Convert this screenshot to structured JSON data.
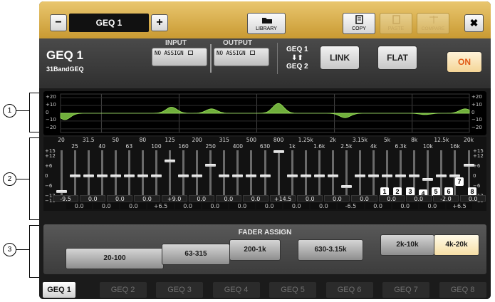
{
  "window": {
    "title": "GEQ 1",
    "minus_label": "−",
    "plus_label": "+",
    "library_label": "LIBRARY",
    "copy_label": "COPY",
    "paste_label": "PASTE",
    "compare_label": "COMPARE",
    "close_label": "✖"
  },
  "header": {
    "name": "GEQ 1",
    "type": "31BandGEQ",
    "input_label": "INPUT",
    "output_label": "OUTPUT",
    "input_value": "NO ASSIGN",
    "output_value": "NO ASSIGN",
    "link_top": "GEQ 1",
    "link_bottom": "GEQ 2",
    "link_label": "LINK",
    "flat_label": "FLAT",
    "on_label": "ON"
  },
  "graph": {
    "y_labels": [
      "+20",
      "+10",
      "0",
      "−10",
      "−20"
    ]
  },
  "bands": {
    "frequencies": [
      "20",
      "25",
      "31.5",
      "40",
      "50",
      "63",
      "80",
      "100",
      "125",
      "160",
      "200",
      "250",
      "315",
      "400",
      "500",
      "630",
      "800",
      "1k",
      "1.25k",
      "1.6k",
      "2k",
      "2.5k",
      "3.15k",
      "4k",
      "5k",
      "6.3k",
      "8k",
      "10k",
      "12.5k",
      "16k",
      "20k"
    ],
    "scale_labels": [
      "+15",
      "+12",
      "+6",
      "0",
      "−6",
      "−12",
      "−15"
    ],
    "gains": [
      -9.5,
      0.0,
      0.0,
      0.0,
      0.0,
      0.0,
      0.0,
      0.0,
      9.0,
      0.0,
      0.0,
      6.5,
      0.0,
      0.0,
      0.0,
      0.0,
      14.5,
      0.0,
      0.0,
      0.0,
      0.0,
      -6.5,
      0.0,
      0.0,
      0.0,
      0.0,
      0.0,
      -2.0,
      0.0,
      0.0,
      6.5
    ],
    "top_values": [
      "-9.5",
      "0.0",
      "0.0",
      "0.0",
      "+9.0",
      "0.0",
      "0.0",
      "0.0",
      "+14.5",
      "0.0",
      "0.0",
      "0.0",
      "0.0",
      "0.0",
      "-2.0",
      "0.0"
    ],
    "bottom_values": [
      "0.0",
      "0.0",
      "0.0",
      "+6.5",
      "0.0",
      "0.0",
      "0.0",
      "0.0",
      "0.0",
      "0.0",
      "-6.5",
      "0.0",
      "0.0",
      "0.0",
      "+6.5"
    ],
    "number_badges": [
      "1",
      "2",
      "3",
      "4",
      "5",
      "6",
      "7",
      "8"
    ]
  },
  "fader_assign": {
    "title": "FADER ASSIGN",
    "buttons": [
      "20-100",
      "63-315",
      "200-1k",
      "630-3.15k",
      "2k-10k",
      "4k-20k"
    ],
    "selected": "4k-20k"
  },
  "tabs": [
    "GEQ 1",
    "GEQ 2",
    "GEQ 3",
    "GEQ 4",
    "GEQ 5",
    "GEQ 6",
    "GEQ 7",
    "GEQ 8"
  ],
  "callouts": [
    "1",
    "2",
    "3"
  ],
  "colors": {
    "accent": "#d9ad4b",
    "curve": "#7cc142",
    "on_button": "#f8dca0"
  }
}
